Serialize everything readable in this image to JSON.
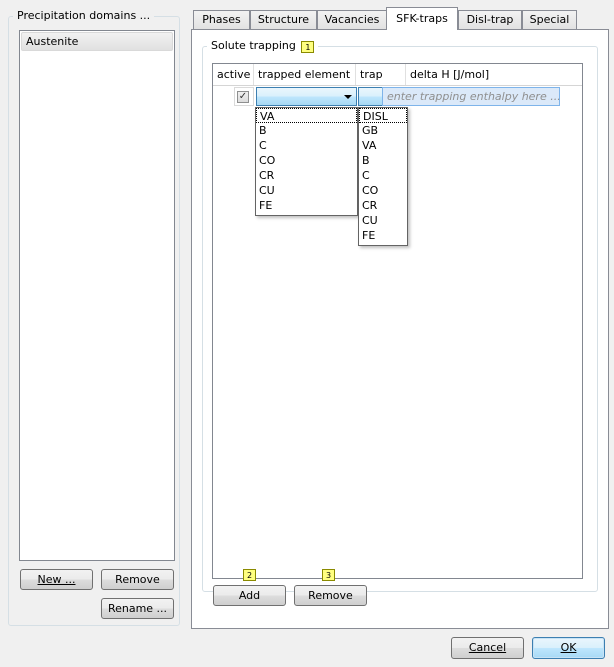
{
  "left_panel": {
    "group_title": "Precipitation domains ...",
    "domains": [
      "Austenite"
    ],
    "buttons": {
      "new": "New ...",
      "remove": "Remove",
      "rename": "Rename ..."
    }
  },
  "tabs": [
    "Phases",
    "Structure",
    "Vacancies",
    "SFK-traps",
    "Disl-trap",
    "Special"
  ],
  "active_tab": "SFK-traps",
  "solute_trapping": {
    "group_title": "Solute trapping",
    "badge": "1",
    "columns": {
      "active": "active",
      "trapped_element": "trapped element",
      "trap": "trap",
      "delta_h": "delta H [J/mol]"
    },
    "row": {
      "checked_glyph": "✓",
      "delta_placeholder": "enter trapping enthalpy here ..."
    },
    "element_options": [
      "VA",
      "B",
      "C",
      "CO",
      "CR",
      "CU",
      "FE"
    ],
    "trap_options": [
      "DISL",
      "GB",
      "VA",
      "B",
      "C",
      "CO",
      "CR",
      "CU",
      "FE"
    ],
    "buttons": {
      "add": "Add",
      "add_badge": "2",
      "remove": "Remove",
      "remove_badge": "3"
    }
  },
  "dialog_buttons": {
    "cancel": "Cancel",
    "ok": "OK"
  }
}
